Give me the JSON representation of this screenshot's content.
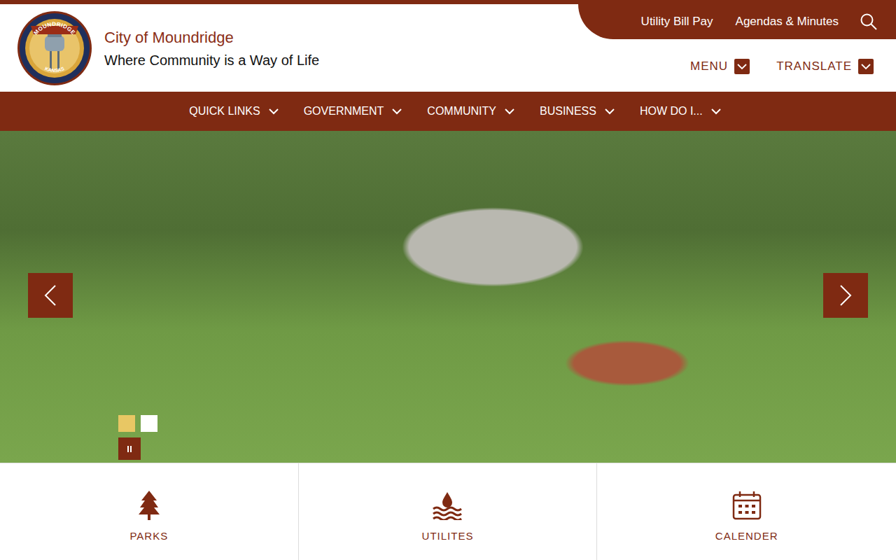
{
  "logo": {
    "top": "MOUNDRIDGE",
    "bottom": "KANSAS"
  },
  "site": {
    "title": "City of Moundridge",
    "tagline": "Where Community is a Way of Life"
  },
  "utility_links": [
    "Utility Bill Pay",
    "Agendas & Minutes"
  ],
  "header_menus": [
    "MENU",
    "TRANSLATE"
  ],
  "nav": [
    "QUICK LINKS",
    "GOVERNMENT",
    "COMMUNITY",
    "BUSINESS",
    "HOW DO I..."
  ],
  "slideshow": {
    "slides": [
      {
        "selected": true
      },
      {
        "selected": false
      }
    ],
    "paused": false
  },
  "tiles": [
    {
      "label": "PARKS",
      "kind": "tree"
    },
    {
      "label": "UTILITES",
      "kind": "water"
    },
    {
      "label": "CALENDER",
      "kind": "calendar"
    }
  ]
}
